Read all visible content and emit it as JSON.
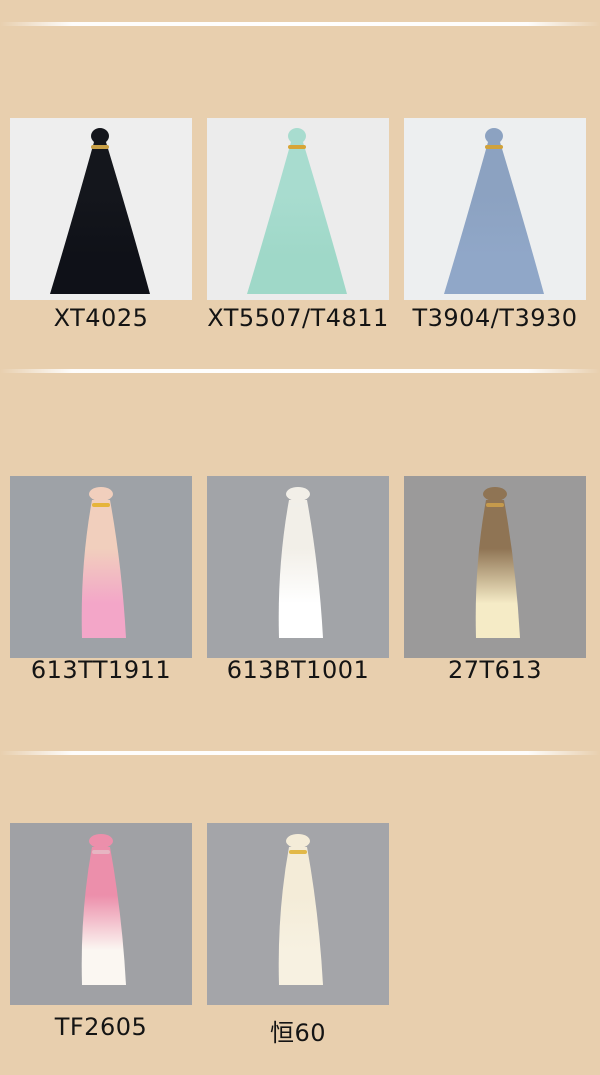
{
  "sections": [
    {
      "items": [
        {
          "label": "XT4025",
          "bg": "#eeeeee",
          "hair_top": "#14161c",
          "hair_bottom": "#0f1118",
          "band": "#c9a046"
        },
        {
          "label": "XT5507/T4811",
          "bg": "#ececec",
          "hair_top": "#a8dccf",
          "hair_bottom": "#9fd8c8",
          "band": "#d7a537"
        },
        {
          "label": "T3904/T3930",
          "bg": "#edeff0",
          "hair_top": "#8ca2c1",
          "hair_bottom": "#90a7c8",
          "band": "#d0a23c"
        }
      ]
    },
    {
      "items": [
        {
          "label": "613TT1911",
          "bg": "#9ea2a7",
          "hair_top": "#f1cfbd",
          "hair_bottom": "#f3a6c8",
          "band": "#e6b43a"
        },
        {
          "label": "613BT1001",
          "bg": "#a2a4a8",
          "hair_top": "#f2efe8",
          "hair_bottom": "#ffffff",
          "band": "#f1efe9"
        },
        {
          "label": "27T613",
          "bg": "#9b9a9a",
          "hair_top": "#8f7454",
          "hair_bottom": "#f5ebc6",
          "band": "#c59a4c"
        }
      ]
    },
    {
      "items": [
        {
          "label": "TF2605",
          "bg": "#a0a1a5",
          "hair_top": "#ec8fab",
          "hair_bottom": "#fbf7f2",
          "band": "#e7b5c2"
        },
        {
          "label": "恒60",
          "bg": "#a4a5a9",
          "hair_top": "#f4ecd8",
          "hair_bottom": "#f7f1e1",
          "band": "#e2b847"
        }
      ]
    }
  ]
}
